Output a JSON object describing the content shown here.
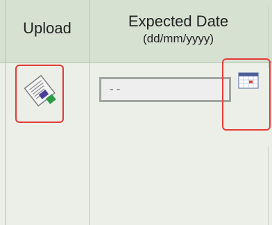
{
  "columns": {
    "upload_label": "Upload",
    "date_label": "Expected Date",
    "date_format": "(dd/mm/yyyy)"
  },
  "date_field": {
    "value": "--"
  },
  "icons": {
    "upload": "upload-document-icon",
    "calendar": "calendar-icon"
  },
  "colors": {
    "header_bg": "#d6e1d2",
    "body_bg": "#ebefe8",
    "highlight": "#e53935"
  }
}
